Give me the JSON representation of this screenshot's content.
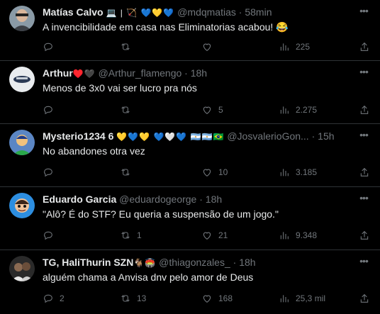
{
  "tweets": [
    {
      "name": "Matías Calvo",
      "name_emoji": "💻 | 🏹 💙💛💙",
      "handle": "@mdqmatias",
      "time": "58min",
      "text": "A invencibilidade em casa nas Eliminatorias acabou! 😂",
      "replies": "",
      "retweets": "",
      "likes": "",
      "views": "225"
    },
    {
      "name": "Arthur",
      "name_emoji": "♥️🖤",
      "handle": "@Arthur_flamengo",
      "time": "18h",
      "text": "Menos de 3x0 vai ser lucro pra nós",
      "replies": "",
      "retweets": "",
      "likes": "5",
      "views": "2.275"
    },
    {
      "name": "Mysterio1234 6",
      "name_emoji": "💛💙💛 💙🤍💙 🇦🇷🇦🇷🇧🇷",
      "handle": "@JosvalerioGon...",
      "time": "15h",
      "text": "No abandones otra vez",
      "replies": "",
      "retweets": "",
      "likes": "10",
      "views": "3.185"
    },
    {
      "name": "Eduardo Garcia",
      "name_emoji": "",
      "handle": "@eduardogeorge",
      "time": "18h",
      "text": "\"Alô? É do STF? Eu queria a suspensão de um jogo.\"",
      "replies": "",
      "retweets": "1",
      "likes": "21",
      "views": "9.348"
    },
    {
      "name": "TG, HaliThurin SZN",
      "name_emoji": "🐐🏟️",
      "handle": "@thiagonzales_",
      "time": "18h",
      "text": "alguém chama a Anvisa dnv pelo amor de Deus",
      "replies": "2",
      "retweets": "13",
      "likes": "168",
      "views": "25,3 mil"
    }
  ],
  "separator": "·",
  "icons": {
    "more": "more-horizontal-icon",
    "reply": "reply-icon",
    "retweet": "retweet-icon",
    "like": "heart-icon",
    "views": "views-chart-icon",
    "share": "share-icon"
  },
  "colors": {
    "background": "#000000",
    "text": "#e7e9ea",
    "muted": "#71767b",
    "divider": "#2f3336"
  }
}
